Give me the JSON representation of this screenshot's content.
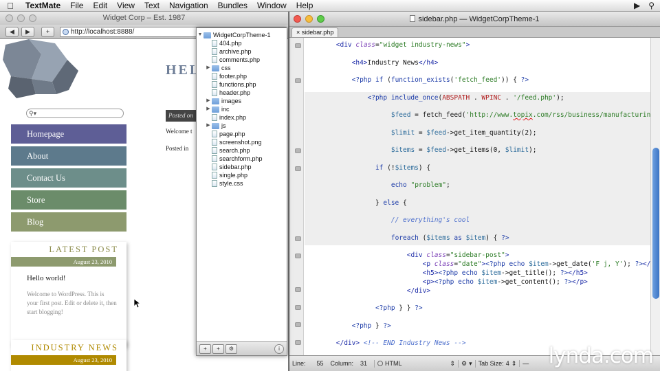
{
  "menubar": {
    "app": "TextMate",
    "items": [
      "File",
      "Edit",
      "View",
      "Text",
      "Navigation",
      "Bundles",
      "Window",
      "Help"
    ]
  },
  "browser": {
    "title": "Widget Corp – Est. 1987",
    "url": "http://localhost:8888/",
    "search_icon": "magnifier-icon",
    "nav": [
      {
        "label": "Homepage",
        "color": "#5e5e96"
      },
      {
        "label": "About",
        "color": "#5d7a8c"
      },
      {
        "label": "Contact Us",
        "color": "#6d8e8a"
      },
      {
        "label": "Store",
        "color": "#6b8c6a"
      },
      {
        "label": "Blog",
        "color": "#8d9a6e"
      }
    ],
    "latest_post": {
      "title": "LATEST POST",
      "title_color": "#8b8b4a",
      "date": "August 23, 2010",
      "date_bg": "#8d9a6e",
      "post_title": "Hello world!",
      "excerpt": "Welcome to WordPress. This is your first post. Edit or delete it, then start blogging!"
    },
    "industry_news": {
      "title": "INDUSTRY NEWS",
      "title_color": "#b08a00",
      "date": "August 23, 2010",
      "date_bg": "#b08a00"
    },
    "heading": "HEL",
    "posted_on": "Posted on",
    "welcome": "Welcome t",
    "posted_in": "Posted in"
  },
  "drawer": {
    "items": [
      {
        "label": "WidgetCorpTheme-1",
        "type": "folder",
        "expanded": true,
        "depth": 0
      },
      {
        "label": "404.php",
        "type": "file",
        "depth": 1
      },
      {
        "label": "archive.php",
        "type": "file",
        "depth": 1
      },
      {
        "label": "comments.php",
        "type": "file",
        "depth": 1
      },
      {
        "label": "css",
        "type": "folder",
        "expanded": false,
        "depth": 1
      },
      {
        "label": "footer.php",
        "type": "file",
        "depth": 1
      },
      {
        "label": "functions.php",
        "type": "file",
        "depth": 1
      },
      {
        "label": "header.php",
        "type": "file",
        "depth": 1
      },
      {
        "label": "images",
        "type": "folder",
        "expanded": false,
        "depth": 1
      },
      {
        "label": "inc",
        "type": "folder",
        "expanded": false,
        "depth": 1
      },
      {
        "label": "index.php",
        "type": "file",
        "depth": 1
      },
      {
        "label": "js",
        "type": "folder",
        "expanded": false,
        "depth": 1
      },
      {
        "label": "page.php",
        "type": "file",
        "depth": 1
      },
      {
        "label": "screenshot.png",
        "type": "file",
        "depth": 1
      },
      {
        "label": "search.php",
        "type": "file",
        "depth": 1
      },
      {
        "label": "searchform.php",
        "type": "file",
        "depth": 1
      },
      {
        "label": "sidebar.php",
        "type": "file",
        "depth": 1
      },
      {
        "label": "single.php",
        "type": "file",
        "depth": 1
      },
      {
        "label": "style.css",
        "type": "file",
        "depth": 1
      }
    ]
  },
  "editor": {
    "title": "sidebar.php — WidgetCorpTheme-1",
    "tab": "sidebar.php",
    "status": {
      "line_label": "Line:",
      "line": "55",
      "column_label": "Column:",
      "column": "31",
      "language": "HTML",
      "tab_size_label": "Tab Size:",
      "tab_size": "4"
    }
  },
  "watermark": "lynda.com"
}
